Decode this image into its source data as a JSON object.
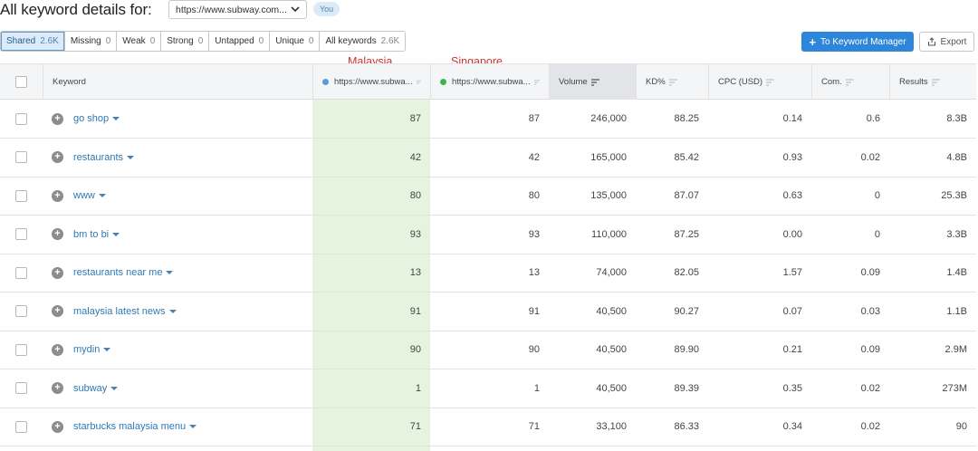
{
  "header": {
    "title": "All keyword details for:",
    "domain_value": "https://www.subway.com...",
    "you_badge": "You"
  },
  "filters": [
    {
      "label": "Shared",
      "count": "2.6K",
      "active": true
    },
    {
      "label": "Missing",
      "count": "0",
      "active": false
    },
    {
      "label": "Weak",
      "count": "0",
      "active": false
    },
    {
      "label": "Strong",
      "count": "0",
      "active": false
    },
    {
      "label": "Untapped",
      "count": "0",
      "active": false
    },
    {
      "label": "Unique",
      "count": "0",
      "active": false
    },
    {
      "label": "All keywords",
      "count": "2.6K",
      "active": false
    }
  ],
  "actions": {
    "to_keyword_manager": "To Keyword Manager",
    "export": "Export"
  },
  "annotations": {
    "col1": "Malaysia",
    "col2": "Singapore"
  },
  "columns": {
    "keyword": "Keyword",
    "domain1": "https://www.subwa...",
    "domain2": "https://www.subwa...",
    "volume": "Volume",
    "kd": "KD%",
    "cpc": "CPC (USD)",
    "com": "Com.",
    "results": "Results"
  },
  "colors": {
    "domain1_dot": "#5b9bd5",
    "domain2_dot": "#3db34a",
    "highlight": "#e6f3df",
    "primary_button": "#2d86d9",
    "annotation": "#d12f2f"
  },
  "rows": [
    {
      "keyword": "go shop",
      "d1": "87",
      "d2": "87",
      "volume": "246,000",
      "kd": "88.25",
      "cpc": "0.14",
      "com": "0.6",
      "results": "8.3B"
    },
    {
      "keyword": "restaurants",
      "d1": "42",
      "d2": "42",
      "volume": "165,000",
      "kd": "85.42",
      "cpc": "0.93",
      "com": "0.02",
      "results": "4.8B"
    },
    {
      "keyword": "www",
      "d1": "80",
      "d2": "80",
      "volume": "135,000",
      "kd": "87.07",
      "cpc": "0.63",
      "com": "0",
      "results": "25.3B"
    },
    {
      "keyword": "bm to bi",
      "d1": "93",
      "d2": "93",
      "volume": "110,000",
      "kd": "87.25",
      "cpc": "0.00",
      "com": "0",
      "results": "3.3B"
    },
    {
      "keyword": "restaurants near me",
      "d1": "13",
      "d2": "13",
      "volume": "74,000",
      "kd": "82.05",
      "cpc": "1.57",
      "com": "0.09",
      "results": "1.4B"
    },
    {
      "keyword": "malaysia latest news",
      "d1": "91",
      "d2": "91",
      "volume": "40,500",
      "kd": "90.27",
      "cpc": "0.07",
      "com": "0.03",
      "results": "1.1B"
    },
    {
      "keyword": "mydin",
      "d1": "90",
      "d2": "90",
      "volume": "40,500",
      "kd": "89.90",
      "cpc": "0.21",
      "com": "0.09",
      "results": "2.9M"
    },
    {
      "keyword": "subway",
      "d1": "1",
      "d2": "1",
      "volume": "40,500",
      "kd": "89.39",
      "cpc": "0.35",
      "com": "0.02",
      "results": "273M"
    },
    {
      "keyword": "starbucks malaysia menu",
      "d1": "71",
      "d2": "71",
      "volume": "33,100",
      "kd": "86.33",
      "cpc": "0.34",
      "com": "0.02",
      "results": "90"
    }
  ]
}
